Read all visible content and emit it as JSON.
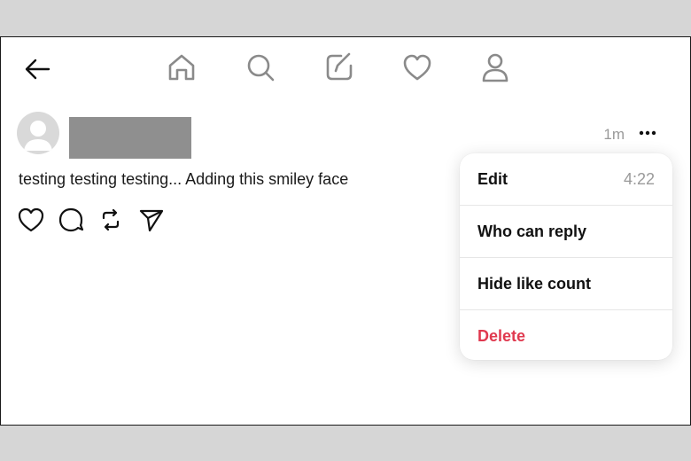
{
  "post": {
    "timestamp": "1m",
    "text": "testing testing testing... Adding this smiley face"
  },
  "nav": {
    "items": [
      {
        "icon": "home-icon"
      },
      {
        "icon": "search-icon"
      },
      {
        "icon": "compose-icon"
      },
      {
        "icon": "heart-icon"
      },
      {
        "icon": "profile-icon"
      }
    ]
  },
  "menu": {
    "items": [
      {
        "label": "Edit",
        "aux": "4:22"
      },
      {
        "label": "Who can reply"
      },
      {
        "label": "Hide like count"
      },
      {
        "label": "Delete"
      }
    ]
  },
  "colors": {
    "danger": "#e0394f",
    "muted": "#9a9a9a",
    "icon": "#8a8a8a"
  }
}
